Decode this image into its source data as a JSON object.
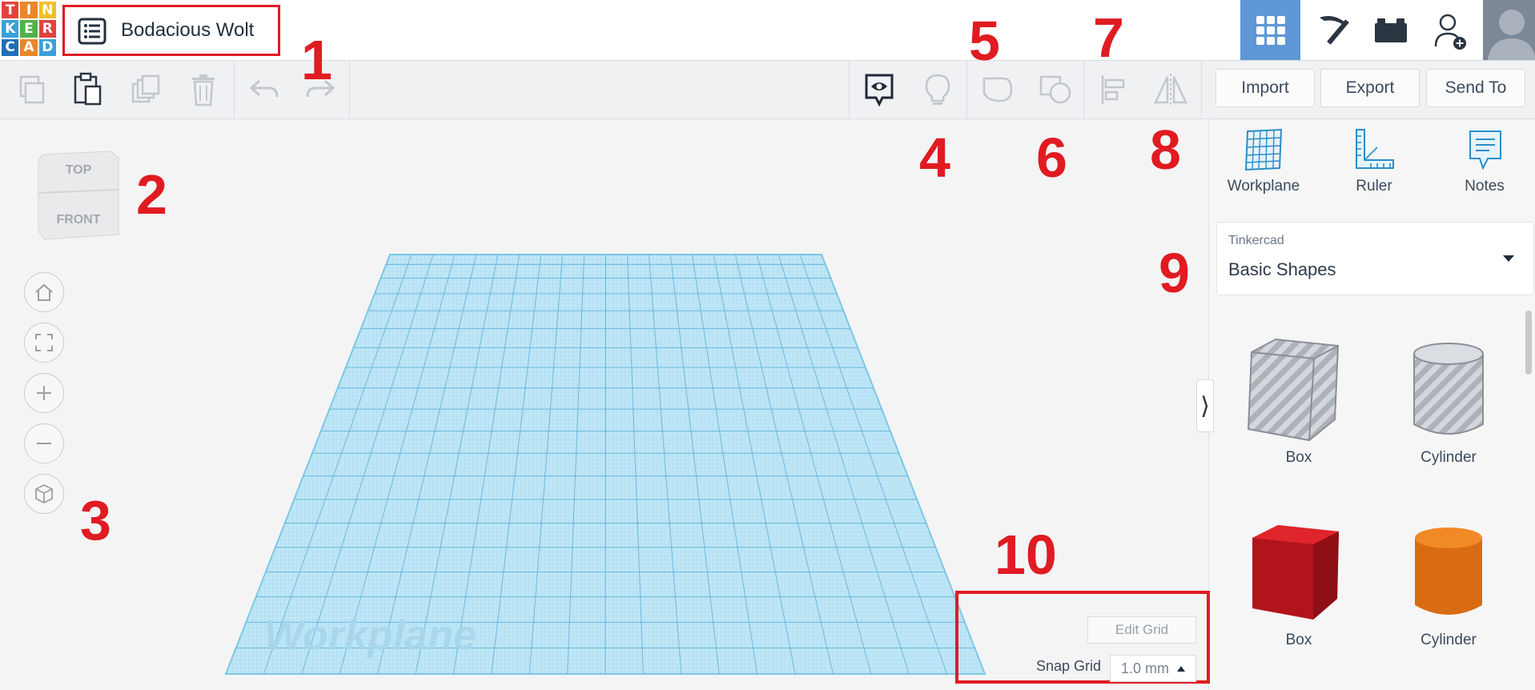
{
  "logo": {
    "letters": [
      "T",
      "I",
      "N",
      "K",
      "E",
      "R",
      "C",
      "A",
      "D"
    ],
    "colors": [
      "#e2423b",
      "#e9872b",
      "#f1bf2a",
      "#3aa0d8",
      "#4fb24a",
      "#e2423b",
      "#1e6fb9",
      "#e9872b",
      "#3aa0d8"
    ]
  },
  "header": {
    "title": "Bodacious Wolt"
  },
  "toolbar": {
    "import_label": "Import",
    "export_label": "Export",
    "send_to_label": "Send To"
  },
  "view_cube": {
    "top_label": "TOP",
    "front_label": "FRONT"
  },
  "right_tools": [
    {
      "label": "Workplane",
      "icon": "workplane-icon"
    },
    {
      "label": "Ruler",
      "icon": "ruler-icon"
    },
    {
      "label": "Notes",
      "icon": "notes-icon"
    }
  ],
  "library": {
    "provider": "Tinkercad",
    "name": "Basic Shapes"
  },
  "shapes": [
    {
      "label": "Box",
      "color": "#b9bcc2"
    },
    {
      "label": "Cylinder",
      "color": "#b9bcc2"
    },
    {
      "label": "Box",
      "color": "#c8161d"
    },
    {
      "label": "Cylinder",
      "color": "#e37717"
    }
  ],
  "workplane": {
    "label": "Workplane"
  },
  "grid": {
    "edit_label": "Edit Grid",
    "snap_label": "Snap Grid",
    "snap_value": "1.0 mm"
  },
  "annotations": [
    "1",
    "2",
    "3",
    "4",
    "5",
    "6",
    "7",
    "8",
    "9",
    "10"
  ],
  "colors": {
    "accent": "#5e97d6",
    "annotation": "#e01b22",
    "grid": "#7fcaea"
  }
}
